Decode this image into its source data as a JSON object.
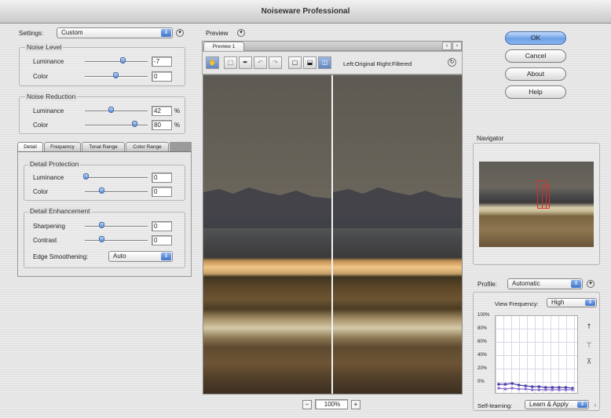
{
  "window": {
    "title": "Noiseware Professional"
  },
  "settings": {
    "label": "Settings:",
    "value": "Custom"
  },
  "noise_level": {
    "title": "Noise Level",
    "luminance": {
      "label": "Luminance",
      "value": "-7",
      "level": 0.55
    },
    "color": {
      "label": "Color",
      "value": "0",
      "level": 0.45
    }
  },
  "noise_reduction": {
    "title": "Noise Reduction",
    "luminance": {
      "label": "Luminance",
      "value": "42",
      "unit": "%",
      "level": 0.42
    },
    "color": {
      "label": "Color",
      "value": "80",
      "unit": "%",
      "level": 0.8
    }
  },
  "tabs": [
    "Detail",
    "Frequency",
    "Tonal Range",
    "Color Range"
  ],
  "detail_protection": {
    "title": "Detail Protection",
    "luminance": {
      "label": "Luminance",
      "value": "0",
      "level": 0.0
    },
    "color": {
      "label": "Color",
      "value": "0",
      "level": 0.25
    }
  },
  "detail_enhancement": {
    "title": "Detail Enhancement",
    "sharpening": {
      "label": "Sharpening",
      "value": "0",
      "level": 0.25
    },
    "contrast": {
      "label": "Contrast",
      "value": "0",
      "level": 0.25
    },
    "edge_smoothening": {
      "label": "Edge Smoothening:",
      "value": "Auto"
    }
  },
  "preview": {
    "label": "Preview",
    "tab": "Preview 1",
    "compare_label": "Left:Original Right:Filtered",
    "zoom": "100%",
    "minus": "−",
    "plus": "+"
  },
  "buttons": {
    "ok": "OK",
    "cancel": "Cancel",
    "about": "About",
    "help": "Help"
  },
  "navigator": {
    "title": "Navigator"
  },
  "profile": {
    "label": "Profile:",
    "value": "Automatic",
    "view_frequency_label": "View Frequency:",
    "view_frequency_value": "High",
    "y_ticks": [
      "100%",
      "80%",
      "60%",
      "40%",
      "20%",
      "0%"
    ],
    "self_learning_label": "Self-learning:",
    "self_learning_value": "Learn & Apply"
  },
  "chart_data": {
    "type": "line",
    "x": [
      1,
      2,
      3,
      4,
      5,
      6,
      7,
      8,
      9,
      10,
      11,
      12
    ],
    "ylim": [
      0,
      100
    ],
    "series": [
      {
        "values": [
          13,
          13,
          14,
          12,
          11,
          10,
          10,
          9,
          9,
          9,
          9,
          8
        ]
      },
      {
        "values": [
          8,
          7,
          8,
          7,
          7,
          6,
          6,
          6,
          6,
          6,
          6,
          6
        ]
      }
    ]
  },
  "colors": {
    "accent": "#5b8bd9",
    "series_a": "#4a3fa6",
    "series_b": "#8a6fcf"
  }
}
